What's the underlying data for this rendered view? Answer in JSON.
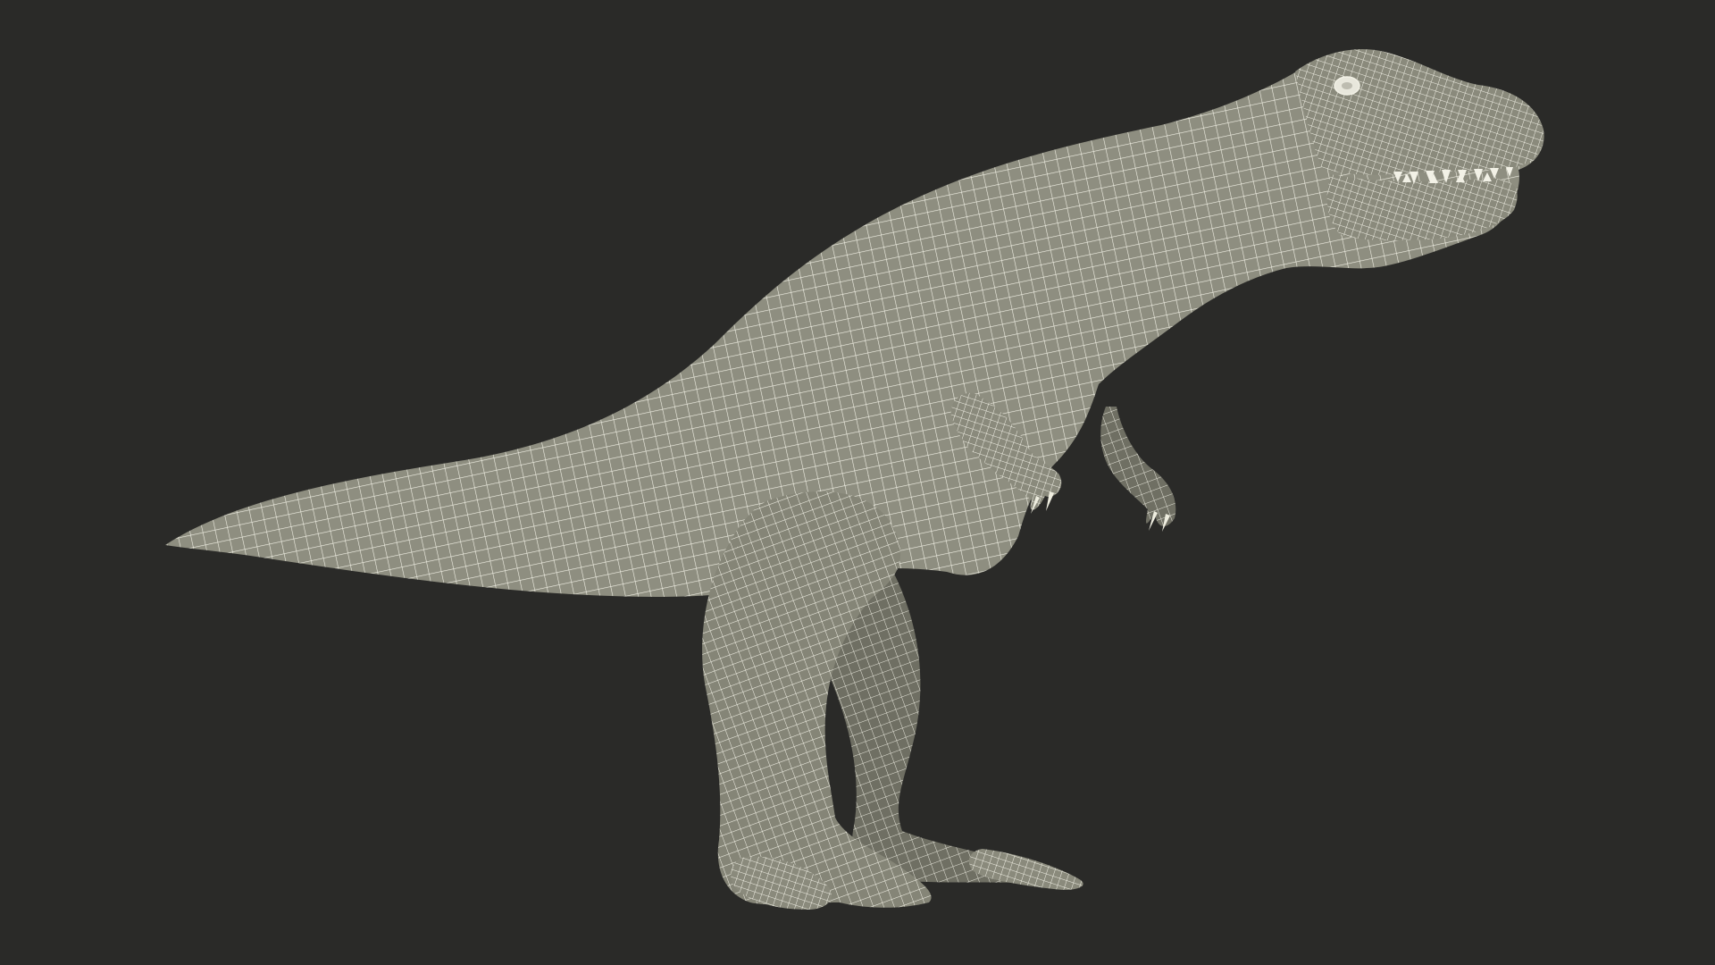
{
  "scene": {
    "background_color": "#2a2a28",
    "subject": "t-rex-wireframe-model",
    "mesh_fill_color": "#8e8e80",
    "mesh_shadow_color": "#6f6f63",
    "wire_color": "#f2f1e6",
    "render_style": "wireframe-over-shaded"
  }
}
